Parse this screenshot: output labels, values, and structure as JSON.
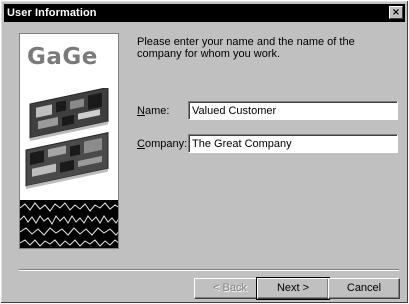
{
  "window": {
    "title": "User Information",
    "close_glyph": "×"
  },
  "sidebar": {
    "logo_text": "GaGe"
  },
  "prompt": "Please enter your name and the name of the company for whom you work.",
  "form": {
    "name_label_accel": "N",
    "name_label_rest": "ame:",
    "name_value": "Valued Customer",
    "company_label_accel": "C",
    "company_label_rest": "ompany:",
    "company_value": "The Great Company"
  },
  "buttons": {
    "back_label": "< Back",
    "next_label": "Next >",
    "cancel_label": "Cancel"
  }
}
